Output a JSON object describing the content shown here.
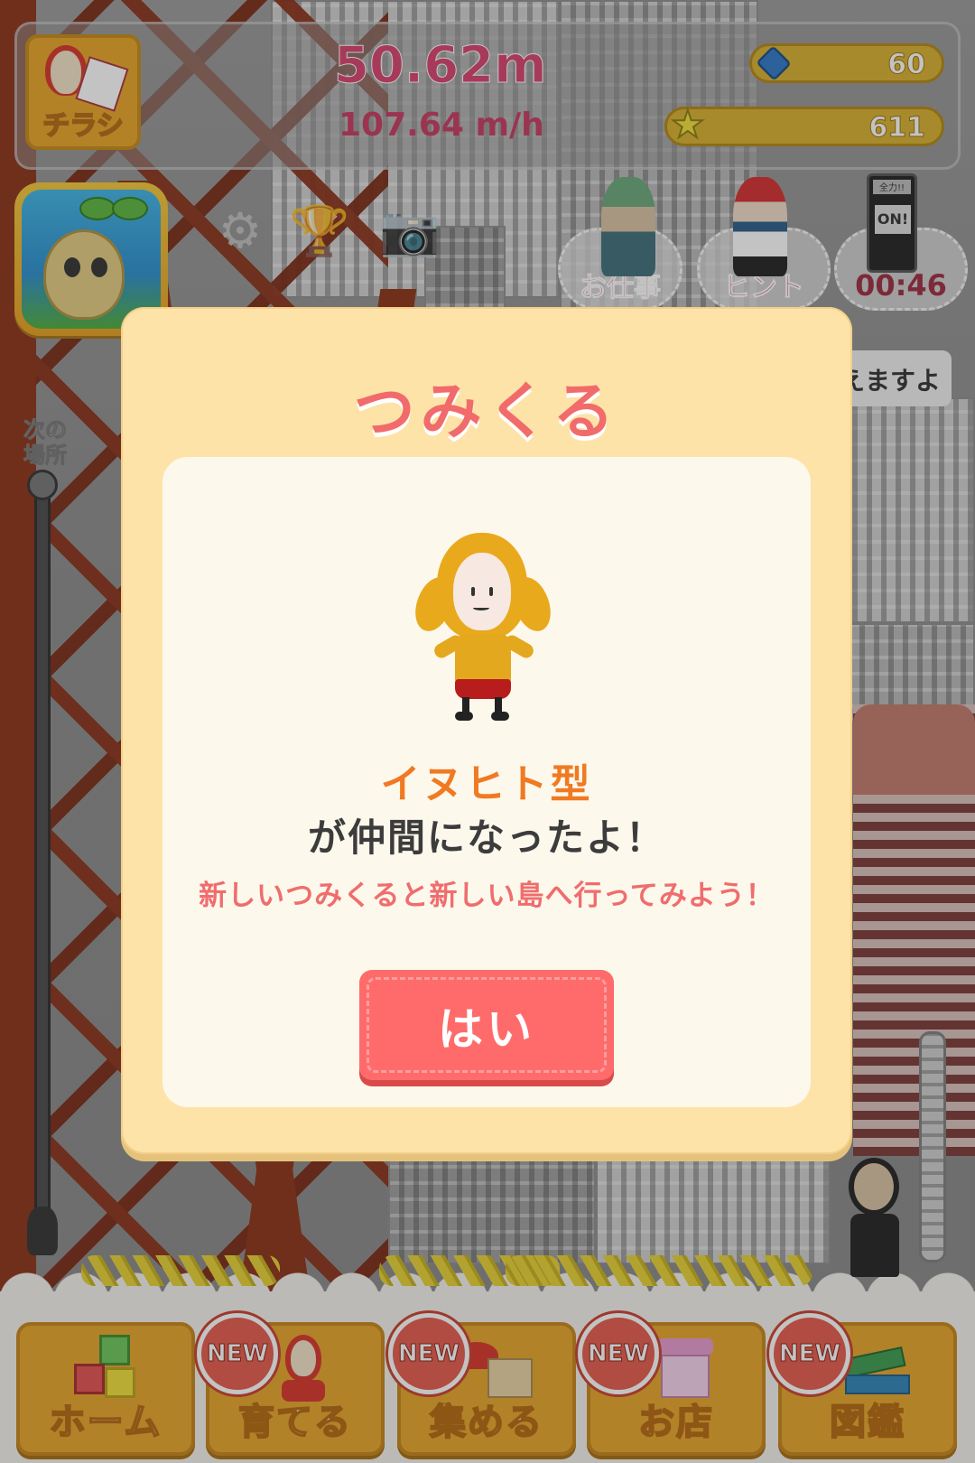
{
  "hud": {
    "flyer_label": "チラシ",
    "distance": "50.62m",
    "speed": "107.64 m/h",
    "gems": "60",
    "stars": "611"
  },
  "toolbar": {
    "job_label": "お仕事",
    "hint_label": "ヒント",
    "timer": "00:46",
    "full_power_label": "全力!!",
    "switch_state": "ON!"
  },
  "speech_text": "えますよ",
  "next_place_label": "次の場所",
  "modal": {
    "title": "つみくる",
    "character_name": "イヌヒト型",
    "joined_text": "が仲間になったよ！",
    "hint_text": "新しいつみくると新しい島へ行ってみよう！",
    "yes_label": "はい"
  },
  "bottom_nav": {
    "new_badge": "NEW",
    "items": [
      {
        "label": "ホーム",
        "icon": "blocks-icon",
        "is_new": false
      },
      {
        "label": "育てる",
        "icon": "character-icon",
        "is_new": true
      },
      {
        "label": "集める",
        "icon": "items-icon",
        "is_new": true
      },
      {
        "label": "お店",
        "icon": "shop-icon",
        "is_new": true
      },
      {
        "label": "図鑑",
        "icon": "book-icon",
        "is_new": true
      }
    ]
  },
  "colors": {
    "accent_pink": "#d8426e",
    "modal_bg": "#fde3a8",
    "title_red": "#f26b6b",
    "name_orange": "#f07a22",
    "button_red": "#ff6b6b",
    "nav_orange": "#e8a52a"
  }
}
